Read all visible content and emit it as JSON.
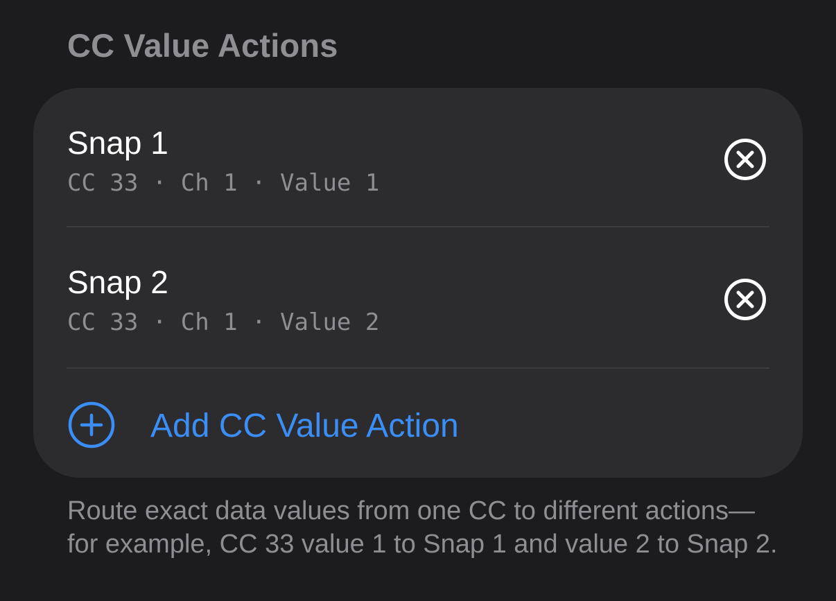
{
  "section": {
    "title": "CC Value Actions"
  },
  "actions": [
    {
      "title": "Snap 1",
      "subtitle": "CC 33 · Ch 1 · Value 1",
      "remove_icon": "xmark-circle-icon"
    },
    {
      "title": "Snap 2",
      "subtitle": "CC 33 · Ch 1 · Value 2",
      "remove_icon": "xmark-circle-icon"
    }
  ],
  "add_action": {
    "label": "Add CC Value Action",
    "icon": "plus-circle-icon"
  },
  "footer": {
    "text": "Route exact data values from one CC to different actions—for example, CC 33 value 1 to Snap 1 and value 2 to Snap 2."
  },
  "colors": {
    "background": "#1c1c1e",
    "card": "#2c2c2e",
    "accent": "#3a8ef6",
    "secondary_text": "#8e8e93",
    "primary_text": "#ffffff"
  }
}
